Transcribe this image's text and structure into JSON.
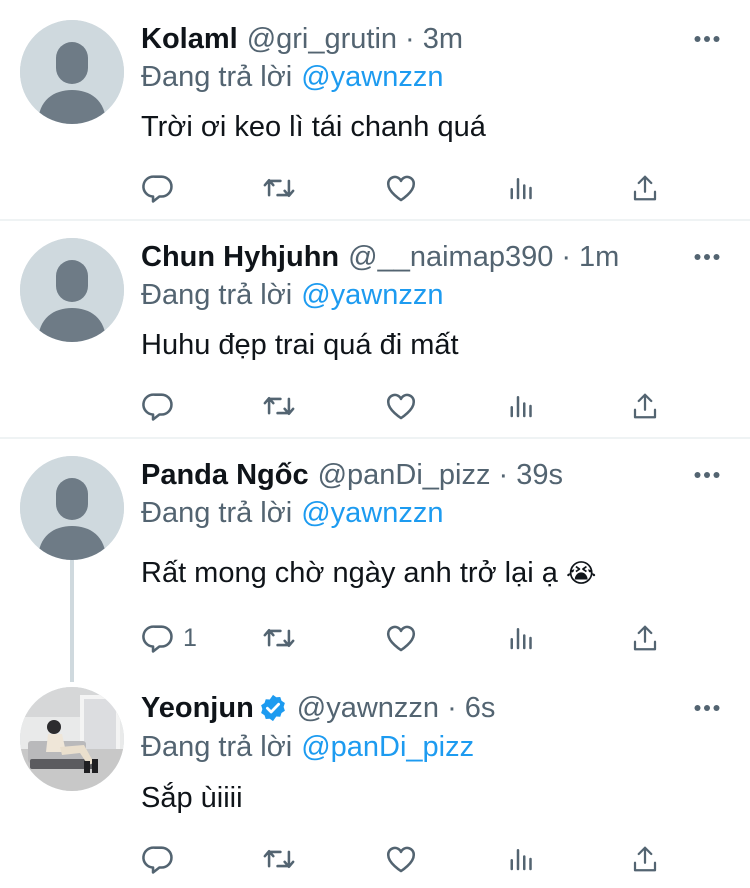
{
  "tweets": [
    {
      "name": "Kolaml",
      "handle": "@gri_grutin",
      "dot": "·",
      "time": "3m",
      "replying_label": "Đang trả lời",
      "replying_to": "@yawnzzn",
      "text": "Trời ơi keo lì tái chanh quá",
      "reply_count": "",
      "avatar": "default-avatar"
    },
    {
      "name": "Chun Hyhjuhn",
      "handle": "@__naimap390",
      "dot": "·",
      "time": "1m",
      "replying_label": "Đang trả lời",
      "replying_to": "@yawnzzn",
      "text": "Huhu đẹp trai quá đi mất",
      "reply_count": "",
      "avatar": "default-avatar"
    },
    {
      "name": "Panda Ngốc",
      "handle": "@panDi_pizz",
      "dot": "·",
      "time": "39s",
      "replying_label": "Đang trả lời",
      "replying_to": "@yawnzzn",
      "text": "Rất mong chờ ngày anh trở lại ạ",
      "emoji": "😭",
      "reply_count": "1",
      "avatar": "default-avatar"
    },
    {
      "name": "Yeonjun",
      "verified": true,
      "handle": "@yawnzzn",
      "dot": "·",
      "time": "6s",
      "replying_label": "Đang trả lời",
      "replying_to": "@panDi_pizz",
      "text": "Sắp ùiiii",
      "reply_count": "",
      "avatar": "photo-avatar"
    }
  ],
  "icons": {
    "more": "more-dots-icon",
    "reply": "reply-icon",
    "retweet": "retweet-icon",
    "like": "like-icon",
    "views": "views-icon",
    "share": "share-icon",
    "verified": "verified-badge-icon"
  },
  "colors": {
    "text_primary": "#0f1419",
    "text_secondary": "#536471",
    "accent": "#1d9bf0",
    "divider": "#eff3f4",
    "avatar_bg": "#cfd9de",
    "avatar_figure": "#6e7b86"
  }
}
